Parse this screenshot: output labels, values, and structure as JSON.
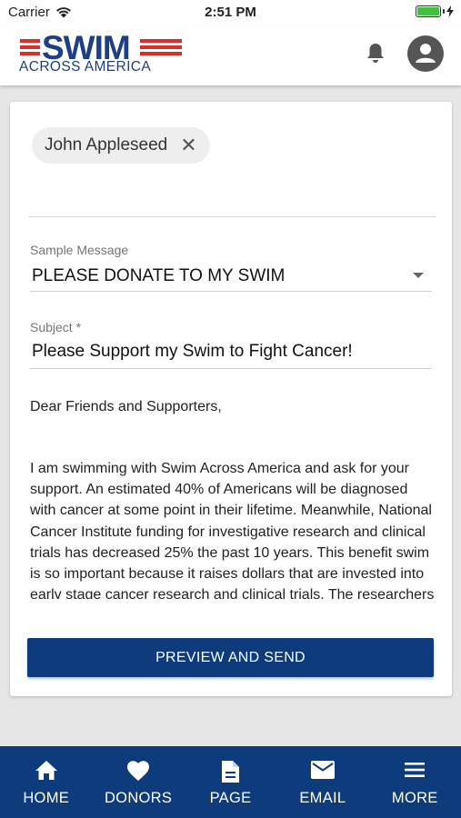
{
  "status_bar": {
    "carrier": "Carrier",
    "time": "2:51 PM"
  },
  "header": {
    "logo_title": "SWIM",
    "logo_subtitle": "ACROSS AMERICA",
    "brand_blue": "#1c3f87",
    "brand_red": "#d9302b"
  },
  "recipients": [
    {
      "name": "John Appleseed"
    }
  ],
  "form": {
    "sample_message_label": "Sample Message",
    "sample_message_value": "PLEASE DONATE TO MY SWIM",
    "subject_label": "Subject *",
    "subject_value": "Please Support my Swim to Fight Cancer!",
    "greeting": "Dear Friends and Supporters,",
    "body": "I am swimming with Swim Across America and ask for your support. An estimated 40% of Americans will be diagnosed with cancer at some point in their lifetime. Meanwhile, National Cancer Institute funding for investigative research and clinical trials has decreased 25% the past 10 years. This benefit swim is so important because it raises dollars that are invested into early stage cancer research and clinical trials. The researchers"
  },
  "actions": {
    "preview_send": "PREVIEW AND SEND"
  },
  "nav": {
    "items": [
      {
        "label": "HOME",
        "icon": "home-icon"
      },
      {
        "label": "DONORS",
        "icon": "heart-icon"
      },
      {
        "label": "PAGE",
        "icon": "document-icon"
      },
      {
        "label": "EMAIL",
        "icon": "mail-icon"
      },
      {
        "label": "MORE",
        "icon": "menu-icon"
      }
    ]
  },
  "colors": {
    "nav_background": "#0d3b7c",
    "button_background": "#0d3b7c"
  }
}
